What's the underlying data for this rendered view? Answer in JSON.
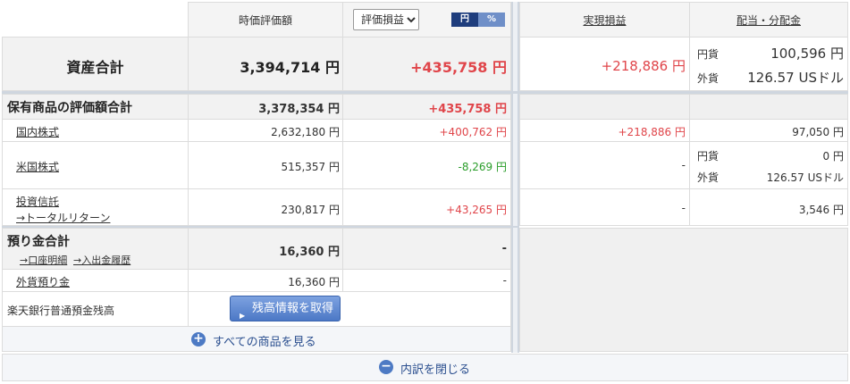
{
  "header": {
    "col_market_value": "時価評価額",
    "unit_select": {
      "selected": "評価損益"
    },
    "toggle": {
      "yen": "円",
      "pct": "%"
    },
    "col_realized": "実現損益",
    "col_dividend": "配当・分配金"
  },
  "total": {
    "label": "資産合計",
    "market_value": "3,394,714 円",
    "pnl": "+435,758 円",
    "realized": "+218,886 円",
    "div_yen_label": "円貨",
    "div_yen_value": "100,596 円",
    "div_fx_label": "外貨",
    "div_fx_value": "126.57 USドル"
  },
  "holdings": {
    "label": "保有商品の評価額合計",
    "market_value": "3,378,354 円",
    "pnl": "+435,758 円"
  },
  "rows": {
    "domestic": {
      "label": "国内株式",
      "market_value": "2,632,180 円",
      "pnl": "+400,762 円",
      "realized": "+218,886 円",
      "dividend": "97,050 円"
    },
    "us": {
      "label": "米国株式",
      "market_value": "515,357 円",
      "pnl": "-8,269 円",
      "realized": "-",
      "div_yen_label": "円貨",
      "div_yen_value": "0 円",
      "div_fx_label": "外貨",
      "div_fx_value": "126.57 USドル"
    },
    "fund": {
      "label": "投資信託",
      "sublink": "→トータルリターン",
      "market_value": "230,817 円",
      "pnl": "+43,265 円",
      "realized": "-",
      "dividend": "3,546 円"
    }
  },
  "deposit": {
    "label": "預り金合計",
    "link_account": "→口座明細",
    "link_history": "→入出金履歴",
    "market_value": "16,360 円",
    "pnl": "-"
  },
  "fx_deposit": {
    "label": "外貨預り金",
    "market_value": "16,360 円",
    "pnl": "-"
  },
  "bank": {
    "label": "楽天銀行普通預金残高",
    "button": "残高情報を取得"
  },
  "footer": {
    "show_all": "すべての商品を見る",
    "close": "内訳を閉じる"
  },
  "colors": {
    "positive": "#e0454a",
    "negative": "#2a9d2a",
    "accent": "#4d7ac4"
  }
}
